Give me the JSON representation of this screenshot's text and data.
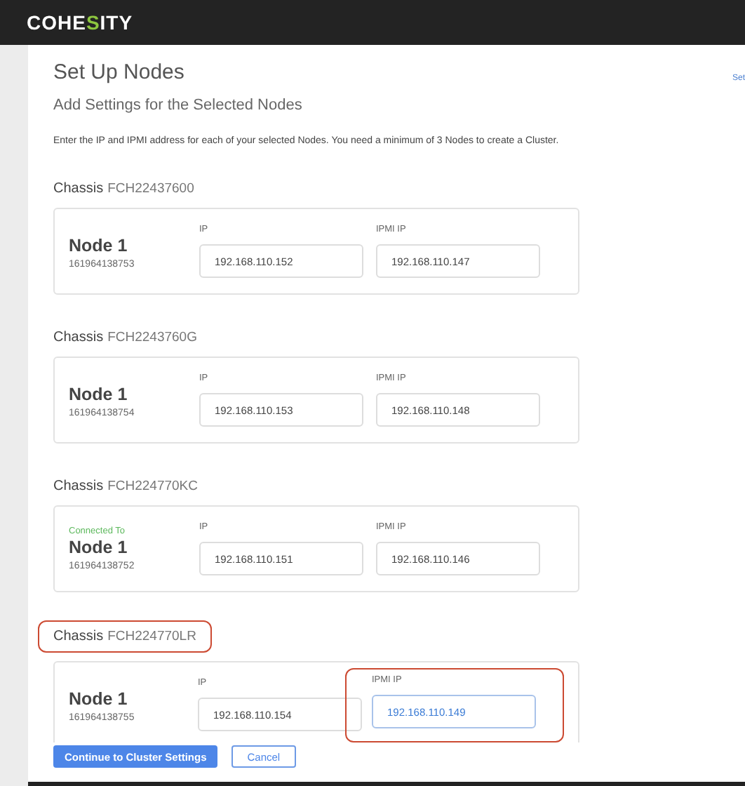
{
  "header": {
    "logo": [
      {
        "text": "COHE",
        "accent": false
      },
      {
        "text": "S",
        "accent": true
      },
      {
        "text": "ITY",
        "accent": false
      }
    ]
  },
  "page": {
    "title": "Set Up Nodes",
    "side_link": "Set",
    "subtitle": "Add Settings for the Selected Nodes",
    "instruction": "Enter the IP and IPMI address for each of your selected Nodes.  You need a minimum of 3 Nodes to create a Cluster."
  },
  "chassis": [
    {
      "label": "Chassis",
      "id": "FCH22437600",
      "highlighted": false,
      "node": {
        "name": "Node 1",
        "serial": "161964138753",
        "fields": [
          {
            "label": "IP",
            "value": "192.168.110.152",
            "focused": false,
            "highlighted": false
          },
          {
            "label": "IPMI IP",
            "value": "192.168.110.147",
            "focused": false,
            "highlighted": false
          }
        ]
      }
    },
    {
      "label": "Chassis",
      "id": "FCH2243760G",
      "highlighted": false,
      "node": {
        "name": "Node 1",
        "serial": "161964138754",
        "fields": [
          {
            "label": "IP",
            "value": "192.168.110.153",
            "focused": false,
            "highlighted": false
          },
          {
            "label": "IPMI IP",
            "value": "192.168.110.148",
            "focused": false,
            "highlighted": false
          }
        ]
      }
    },
    {
      "label": "Chassis",
      "id": "FCH224770KC",
      "highlighted": false,
      "node": {
        "status": "Connected To",
        "name": "Node 1",
        "serial": "161964138752",
        "fields": [
          {
            "label": "IP",
            "value": "192.168.110.151",
            "focused": false,
            "highlighted": false
          },
          {
            "label": "IPMI IP",
            "value": "192.168.110.146",
            "focused": false,
            "highlighted": false
          }
        ]
      }
    },
    {
      "label": "Chassis",
      "id": "FCH224770LR",
      "highlighted": true,
      "node": {
        "name": "Node 1",
        "serial": "161964138755",
        "fields": [
          {
            "label": "IP",
            "value": "192.168.110.154",
            "focused": false,
            "highlighted": false
          },
          {
            "label": "IPMI IP",
            "value": "192.168.110.149",
            "focused": true,
            "highlighted": true
          }
        ]
      }
    }
  ],
  "footer": {
    "primary": "Continue to Cluster Settings",
    "secondary": "Cancel"
  }
}
